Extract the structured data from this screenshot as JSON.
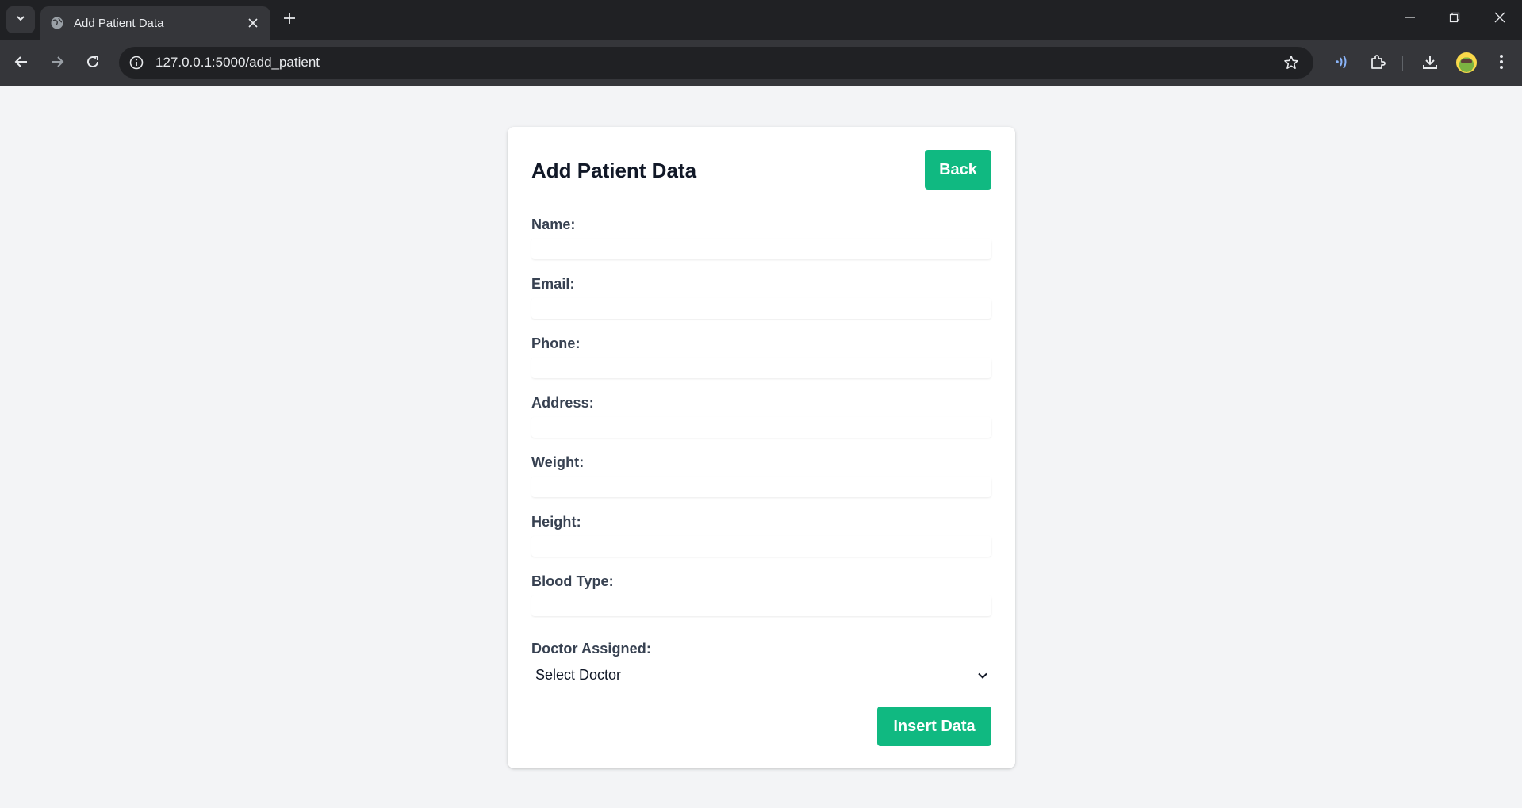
{
  "browser": {
    "tab_title": "Add Patient Data",
    "url": "127.0.0.1:5000/add_patient",
    "icons": {
      "tab_search": "chevron-down-icon",
      "favicon": "globe-icon",
      "tab_close": "close-icon",
      "new_tab": "plus-icon",
      "back": "arrow-left-icon",
      "forward": "arrow-right-icon",
      "reload": "reload-icon",
      "site_info": "info-icon",
      "bookmark": "star-icon",
      "read_aloud": "wireless-icon",
      "extensions": "puzzle-icon",
      "downloads": "download-icon",
      "menu": "more-vertical-icon"
    }
  },
  "page": {
    "title": "Add Patient Data",
    "back_label": "Back",
    "submit_label": "Insert Data",
    "fields": [
      {
        "label": "Name:",
        "value": ""
      },
      {
        "label": "Email:",
        "value": ""
      },
      {
        "label": "Phone:",
        "value": ""
      },
      {
        "label": "Address:",
        "value": ""
      },
      {
        "label": "Weight:",
        "value": ""
      },
      {
        "label": "Height:",
        "value": ""
      },
      {
        "label": "Blood Type:",
        "value": ""
      }
    ],
    "doctor": {
      "label": "Doctor Assigned:",
      "selected": "Select Doctor"
    }
  },
  "colors": {
    "accent": "#10b981",
    "page_bg": "#f3f4f6",
    "chrome_dark": "#202124",
    "chrome_toolbar": "#35363a"
  }
}
